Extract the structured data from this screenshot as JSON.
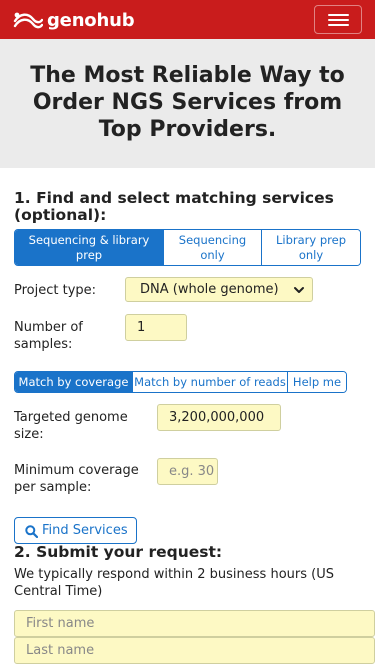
{
  "brand": {
    "name": "genohub",
    "logo_icon": "genohub-logo-icon",
    "color": "#c91c1c"
  },
  "nav": {
    "menu_icon": "hamburger-icon"
  },
  "hero": {
    "line1": "The Most Reliable Way to",
    "line2": "Order NGS Services from",
    "line3": "Top Providers."
  },
  "step1": {
    "title_line1": "1. Find and select matching services",
    "title_line2": "(optional):",
    "service_tabs": [
      {
        "line1": "Sequencing & library",
        "line2": "prep",
        "active": true
      },
      {
        "line1": "Sequencing",
        "line2": "only",
        "active": false
      },
      {
        "line1": "Library prep",
        "line2": "only",
        "active": false
      }
    ],
    "project_type_label": "Project type:",
    "project_type_value": "DNA (whole genome)",
    "samples_label_line1": "Number of",
    "samples_label_line2": "samples:",
    "samples_value": "1",
    "match_tabs": [
      {
        "label": "Match by coverage",
        "active": true
      },
      {
        "label": "Match by number of reads",
        "active": false
      },
      {
        "label": "Help me",
        "active": false
      }
    ],
    "genome_label_line1": "Targeted genome",
    "genome_label_line2": "size:",
    "genome_value": "3,200,000,000",
    "coverage_label_line1": "Minimum coverage",
    "coverage_label_line2": "per sample:",
    "coverage_placeholder": "e.g. 30",
    "find_button": "Find Services"
  },
  "step2": {
    "title": "2. Submit your request:",
    "note": "We typically respond within 2 business hours (US Central Time)",
    "first_name_placeholder": "First name",
    "last_name_placeholder": "Last name"
  },
  "colors": {
    "accent": "#1a73c9",
    "field_bg": "#fdf9c4",
    "hero_bg": "#ebebeb"
  }
}
